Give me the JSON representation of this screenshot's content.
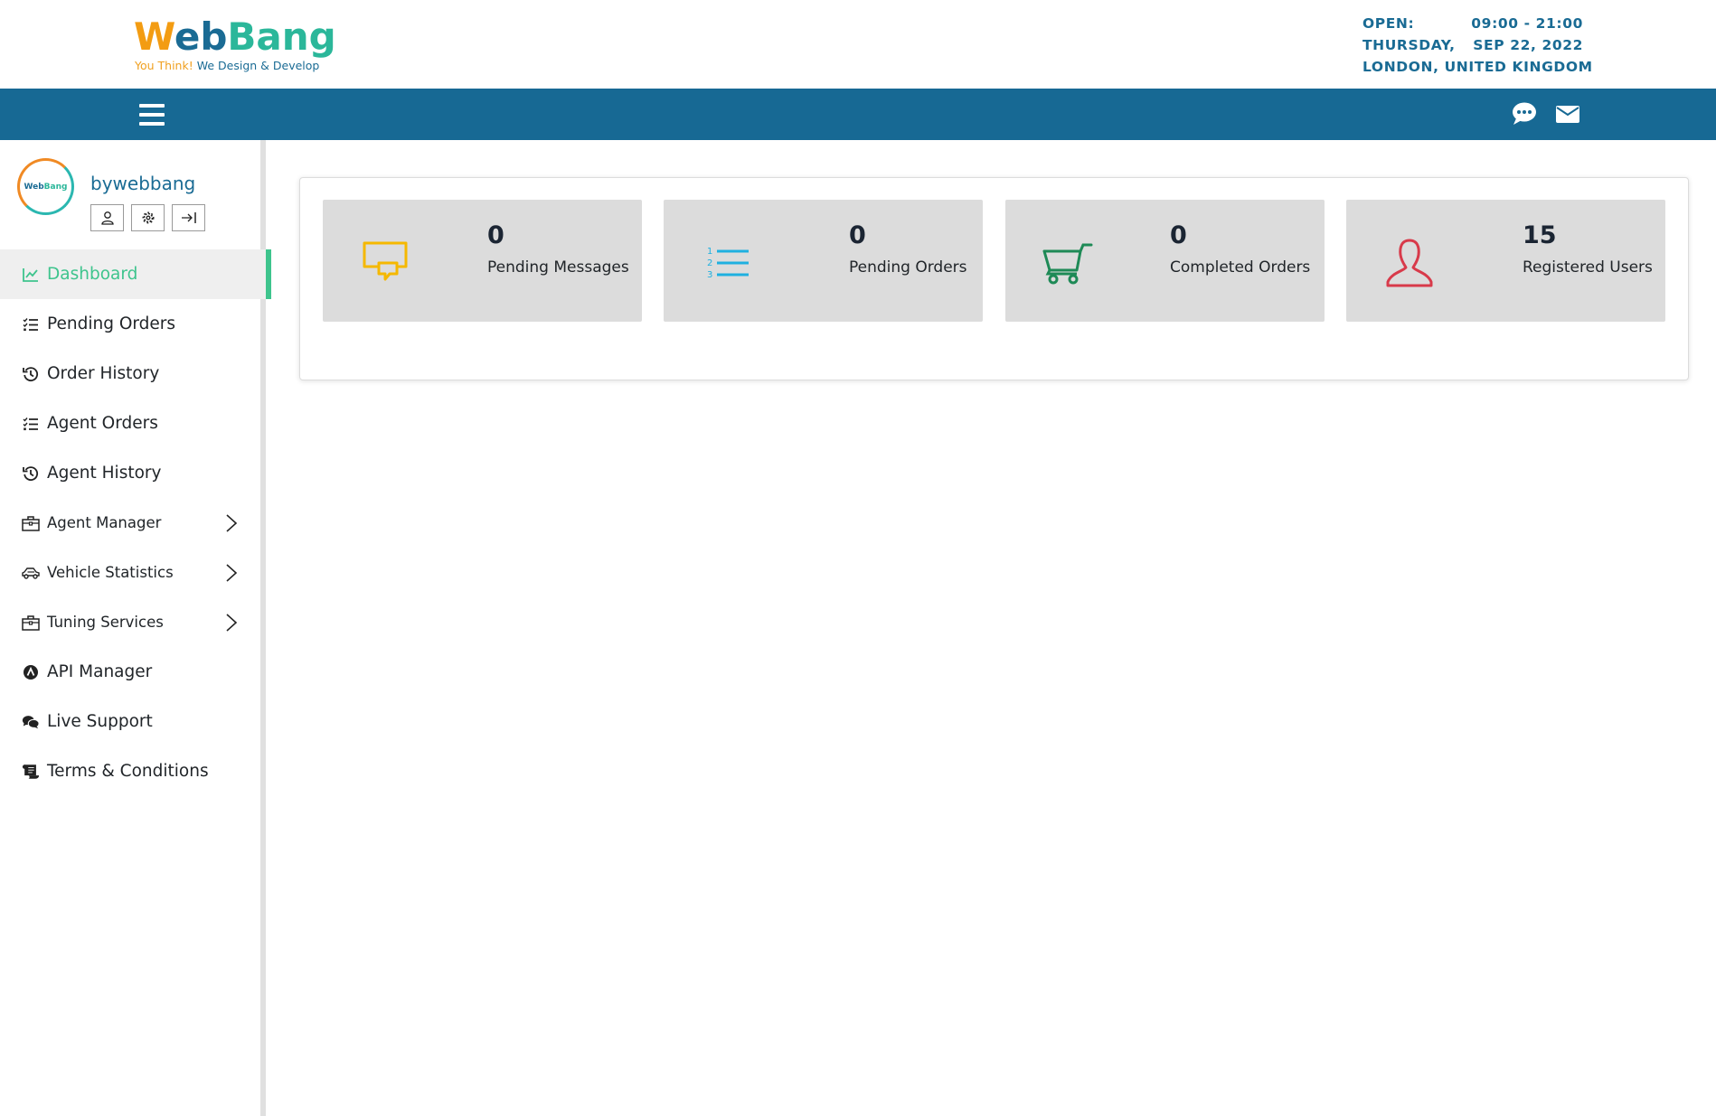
{
  "brand": {
    "logo_w": "W",
    "logo_eb": "eb",
    "logo_bang": "Bang",
    "tagline_a": "You Think!",
    "tagline_b": "We Design & Develop"
  },
  "hours": {
    "open_label": "OPEN:",
    "open_value": "09:00 - 21:00",
    "day": "THURSDAY,",
    "date": "SEP 22, 2022",
    "location": "LONDON, UNITED KINGDOM"
  },
  "navbar": {
    "icons": [
      "menu-icon",
      "chat-icon",
      "envelope-icon"
    ]
  },
  "user": {
    "avatar_text_a": "Web",
    "avatar_text_b": "Bang",
    "name": "bywebbang",
    "buttons": [
      "user-icon",
      "gear-icon",
      "logout-icon"
    ]
  },
  "menu": {
    "items": [
      {
        "label": "Dashboard",
        "icon": "chart-line-icon"
      },
      {
        "label": "Pending Orders",
        "icon": "list-check-icon"
      },
      {
        "label": "Order History",
        "icon": "history-icon"
      },
      {
        "label": "Agent Orders",
        "icon": "list-check-icon"
      },
      {
        "label": "Agent History",
        "icon": "history-icon"
      },
      {
        "label": "Agent Manager",
        "icon": "briefcase-icon"
      },
      {
        "label": "Vehicle Statistics",
        "icon": "car-icon"
      },
      {
        "label": "Tuning Services",
        "icon": "briefcase-icon"
      },
      {
        "label": "API Manager",
        "icon": "api-icon"
      },
      {
        "label": "Live Support",
        "icon": "comments-icon"
      },
      {
        "label": "Terms & Conditions",
        "icon": "scroll-icon"
      }
    ]
  },
  "stats": [
    {
      "value": "0",
      "label": "Pending Messages",
      "icon": "messages-icon",
      "color": "#f5b800"
    },
    {
      "value": "0",
      "label": "Pending Orders",
      "icon": "ordered-list-icon",
      "color": "#1fb0e0"
    },
    {
      "value": "0",
      "label": "Completed Orders",
      "icon": "cart-icon",
      "color": "#1e8a56"
    },
    {
      "value": "15",
      "label": "Registered Users",
      "icon": "user-icon",
      "color": "#d83a4a"
    }
  ],
  "colors": {
    "navbar": "#176994",
    "brand_blue": "#1a6b94",
    "active_green": "#3ec48d",
    "card_bg": "#dcdcdc"
  }
}
